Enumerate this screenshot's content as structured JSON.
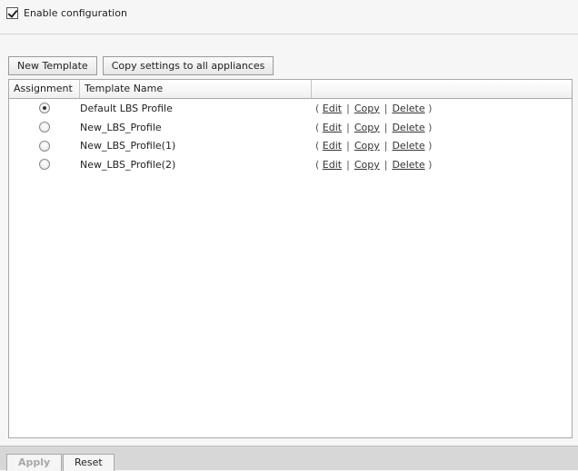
{
  "config": {
    "enable_label": "Enable configuration",
    "enabled": true
  },
  "toolbar": {
    "new_template": "New Template",
    "copy_settings": "Copy settings to all appliances"
  },
  "table": {
    "headers": [
      "Assignment",
      "Template Name",
      ""
    ],
    "rows": [
      {
        "name": "Default LBS Profile",
        "selected": true
      },
      {
        "name": "New_LBS_Profile",
        "selected": false
      },
      {
        "name": "New_LBS_Profile(1)",
        "selected": false
      },
      {
        "name": "New_LBS_Profile(2)",
        "selected": false
      }
    ],
    "actions": {
      "open": "(",
      "edit": "Edit",
      "sep": "|",
      "copy": "Copy",
      "delete": "Delete",
      "close": ")"
    }
  },
  "footer": {
    "apply": "Apply",
    "reset": "Reset"
  }
}
